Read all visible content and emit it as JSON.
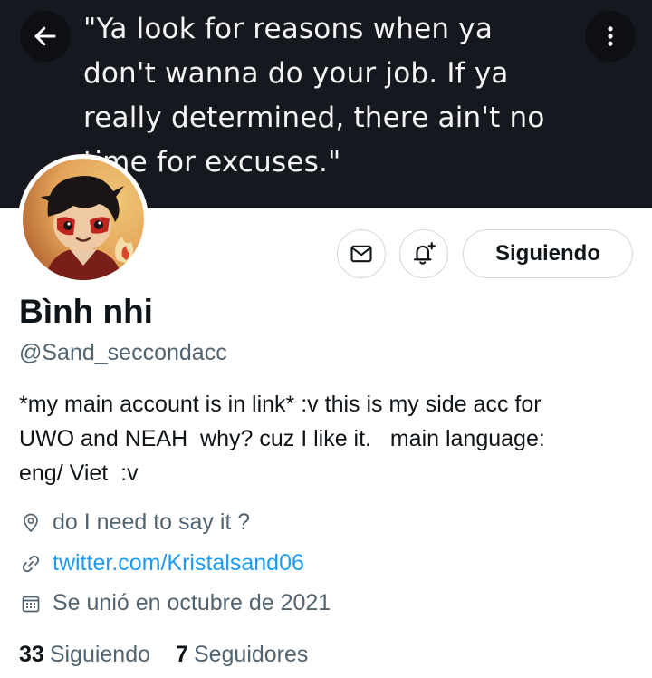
{
  "banner": {
    "quote": "\"Ya look for reasons when ya\ndon't wanna do your job. If ya\nreally determined, there ain't no\ntime for excuses.\""
  },
  "actions": {
    "follow_label": "Siguiendo"
  },
  "profile": {
    "name": "Bình nhi",
    "handle": "@Sand_seccondacc",
    "bio": "*my main account is in link* :v this is my side acc for\nUWO and NEAH  why? cuz I like it.   main language:\neng/ Viet  :v",
    "location": "do I need to say it ?",
    "link": "twitter.com/Kristalsand06",
    "joined": "Se unió en octubre de 2021"
  },
  "stats": {
    "following_count": "33",
    "following_label": "Siguiendo",
    "followers_count": "7",
    "followers_label": "Seguidores"
  },
  "colors": {
    "banner_bg": "#16181f",
    "text_primary": "#0f1419",
    "text_secondary": "#536471",
    "link": "#1d9bf0",
    "border": "#cfd9de"
  },
  "icons": {
    "back": "arrow-left-icon",
    "more": "more-vertical-icon",
    "message": "envelope-icon",
    "notifications": "bell-plus-icon",
    "location": "location-pin-icon",
    "link": "link-icon",
    "joined": "calendar-icon"
  }
}
